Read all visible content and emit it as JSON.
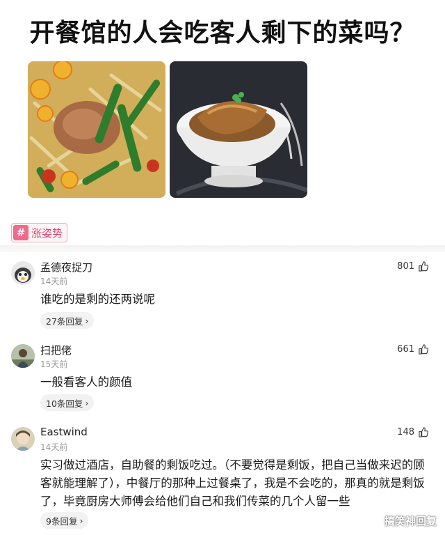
{
  "headline": "开餐馆的人会吃客人剩下的菜吗？",
  "topic": {
    "symbol": "#",
    "label": "涨姿势"
  },
  "comments": [
    {
      "user": "孟德夜捉刀",
      "time": "14天前",
      "likes": "801",
      "text": "谁吃的是剩的还两说呢",
      "replies": "27条回复",
      "reply_arrow": "›"
    },
    {
      "user": "扫把佬",
      "time": "15天前",
      "likes": "661",
      "text": "一般看客人的颜值",
      "replies": "10条回复",
      "reply_arrow": "›"
    },
    {
      "user": "Eastwind",
      "time": "14天前",
      "likes": "148",
      "text": "实习做过酒店，自助餐的剩饭吃过。（不要觉得是剩饭，把自己当做来迟的顾客就能理解了），中餐厅的那种上过餐桌了，我是不会吃的，那真的就是剩饭了，毕竟厨房大师傅会给他们自己和我们传菜的几个人留一些",
      "replies": "9条回复",
      "reply_arrow": "›"
    }
  ],
  "watermark": "搞笑神回复",
  "colors": {
    "topic_accent": "#f06a8a",
    "topic_text": "#e0486e"
  }
}
